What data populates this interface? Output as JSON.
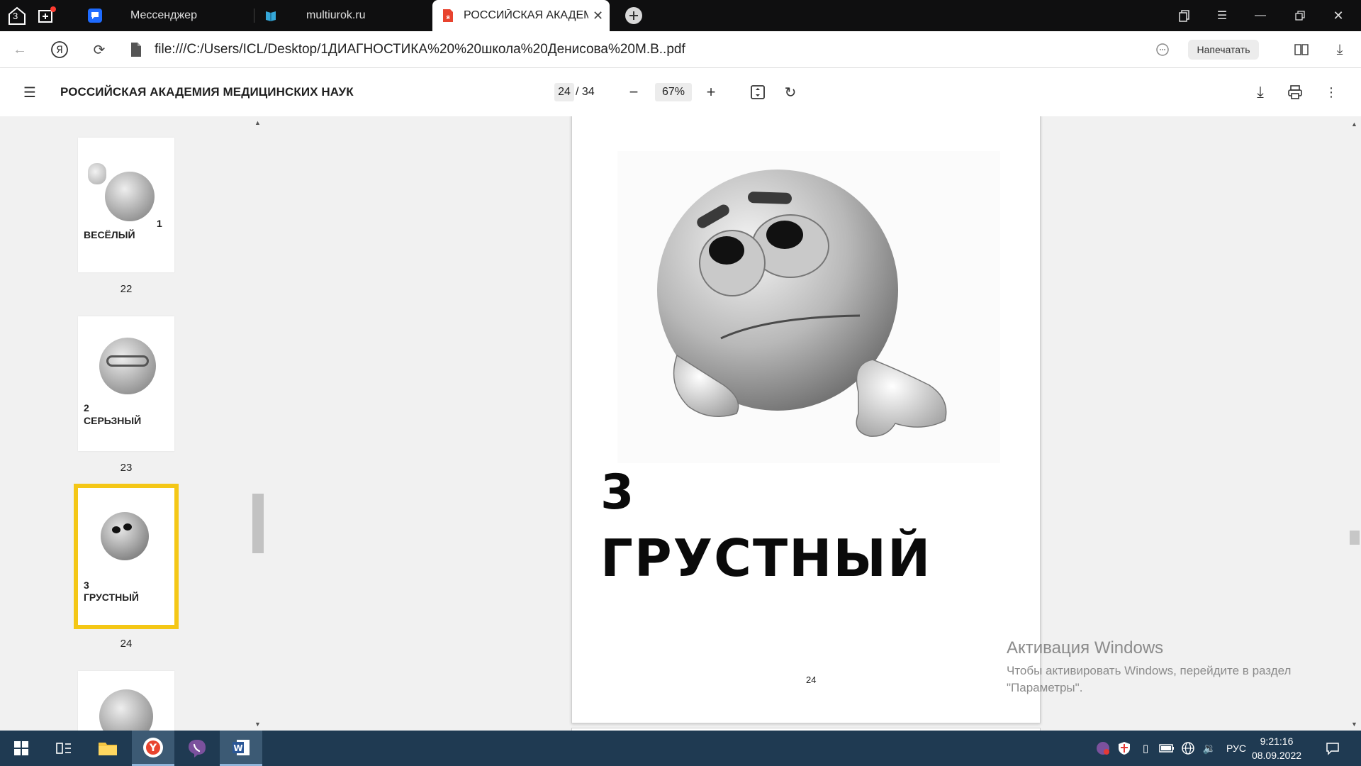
{
  "tabbar": {
    "home_badge": "3",
    "tabs": [
      {
        "label": "Мессенджер"
      },
      {
        "label": "multiurok.ru"
      },
      {
        "label": "РОССИЙСКАЯ АКАДЕМ"
      }
    ]
  },
  "addressbar": {
    "url": "file:///C:/Users/ICL/Desktop/1ДИАГНОСТИКА%20%20школа%20Денисова%20М.В..pdf",
    "print_label": "Напечатать"
  },
  "pdf_toolbar": {
    "title": "РОССИЙСКАЯ АКАДЕМИЯ МЕДИЦИНСКИХ НАУК",
    "current_page": "24",
    "total_pages": "/ 34",
    "zoom": "67%"
  },
  "sidebar": {
    "thumbs": [
      {
        "number": "22",
        "label_top": "1",
        "label_bottom": "ВЕСЁЛЫЙ"
      },
      {
        "number": "23",
        "label_top": "2",
        "label_bottom": "СЕРЬЗНЫЙ"
      },
      {
        "number": "24",
        "label_top": "3",
        "label_bottom": "ГРУСТНЫЙ"
      }
    ]
  },
  "page": {
    "digit": "3",
    "word": "ГРУСТНЫЙ",
    "footer_number": "24"
  },
  "activation": {
    "title": "Активация Windows",
    "line1": "Чтобы активировать Windows, перейдите в раздел",
    "line2": "\"Параметры\"."
  },
  "taskbar": {
    "lang": "РУС",
    "time": "9:21:16",
    "date": "08.09.2022"
  },
  "colors": {
    "selection_outline": "#f4c716",
    "taskbar_bg": "#1f3a52",
    "tabbar_bg": "#0f0f10"
  }
}
